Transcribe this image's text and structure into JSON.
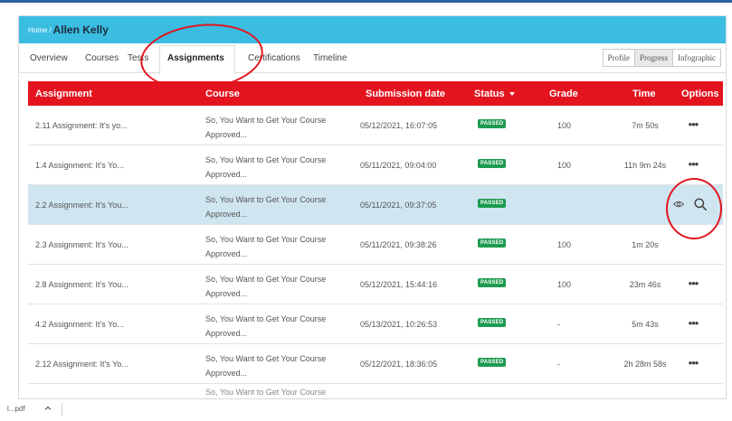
{
  "breadcrumb": {
    "home": "Home",
    "separator": "/",
    "current": "Allen Kelly"
  },
  "tabs": [
    {
      "label": "Overview"
    },
    {
      "label": "Courses"
    },
    {
      "label": "Tests"
    },
    {
      "label": "Assignments"
    },
    {
      "label": "Certifications"
    },
    {
      "label": "Timeline"
    }
  ],
  "active_tab": "Assignments",
  "view_toggle": [
    "Profile",
    "Progress",
    "Infographic"
  ],
  "active_view": "Progress",
  "table": {
    "columns": [
      "Assignment",
      "Course",
      "Submission date",
      "Status",
      "Grade",
      "Time",
      "Options"
    ],
    "sorted_by": "Status",
    "rows": [
      {
        "assignment": "2.11 Assignment: It's yo...",
        "course_line1": "So, You Want to Get Your Course",
        "course_line2": "Approved...",
        "date": "05/12/2021, 16:07:05",
        "status": "PASSED",
        "grade": "100",
        "time": "7m 50s",
        "options": "•••"
      },
      {
        "assignment": "1.4 Assignment: It's Yo...",
        "course_line1": "So, You Want to Get Your Course",
        "course_line2": "Approved...",
        "date": "05/11/2021, 09:04:00",
        "status": "PASSED",
        "grade": "100",
        "time": "11h 9m 24s",
        "options": "•••"
      },
      {
        "assignment": "2.2 Assignment: It's You...",
        "course_line1": "So, You Want to Get Your Course",
        "course_line2": "Approved...",
        "date": "05/11/2021, 09:37:05",
        "status": "PASSED",
        "grade": "",
        "time": "",
        "options": ""
      },
      {
        "assignment": "2.3 Assignment: It's You...",
        "course_line1": "So, You Want to Get Your Course",
        "course_line2": "Approved...",
        "date": "05/11/2021, 09:38:26",
        "status": "PASSED",
        "grade": "100",
        "time": "1m 20s",
        "options": ""
      },
      {
        "assignment": "2.8 Assignment: It's You...",
        "course_line1": "So, You Want to Get Your Course",
        "course_line2": "Approved...",
        "date": "05/12/2021, 15:44:16",
        "status": "PASSED",
        "grade": "100",
        "time": "23m 46s",
        "options": "•••"
      },
      {
        "assignment": "4.2 Assignment: It's Yo...",
        "course_line1": "So, You Want to Get Your Course",
        "course_line2": "Approved...",
        "date": "05/13/2021, 10:26:53",
        "status": "PASSED",
        "grade": "-",
        "time": "5m 43s",
        "options": "•••"
      },
      {
        "assignment": "2.12 Assignment: It's Yo...",
        "course_line1": "So, You Want to Get Your Course",
        "course_line2": "Approved...",
        "date": "05/12/2021, 18:36:05",
        "status": "PASSED",
        "grade": "-",
        "time": "2h 28m 58s",
        "options": "•••"
      }
    ],
    "partial_row_course": "So, You Want to Get Your Course"
  },
  "highlight_row_actions": [
    "eye-icon",
    "search-icon"
  ],
  "download": {
    "file": "l...pdf"
  },
  "colors": {
    "header_blue": "#3bbde2",
    "table_header_red": "#e3141e",
    "status_green": "#1d9b50",
    "highlight_row": "#cfe6f1",
    "annotation_red": "#e3141e"
  }
}
